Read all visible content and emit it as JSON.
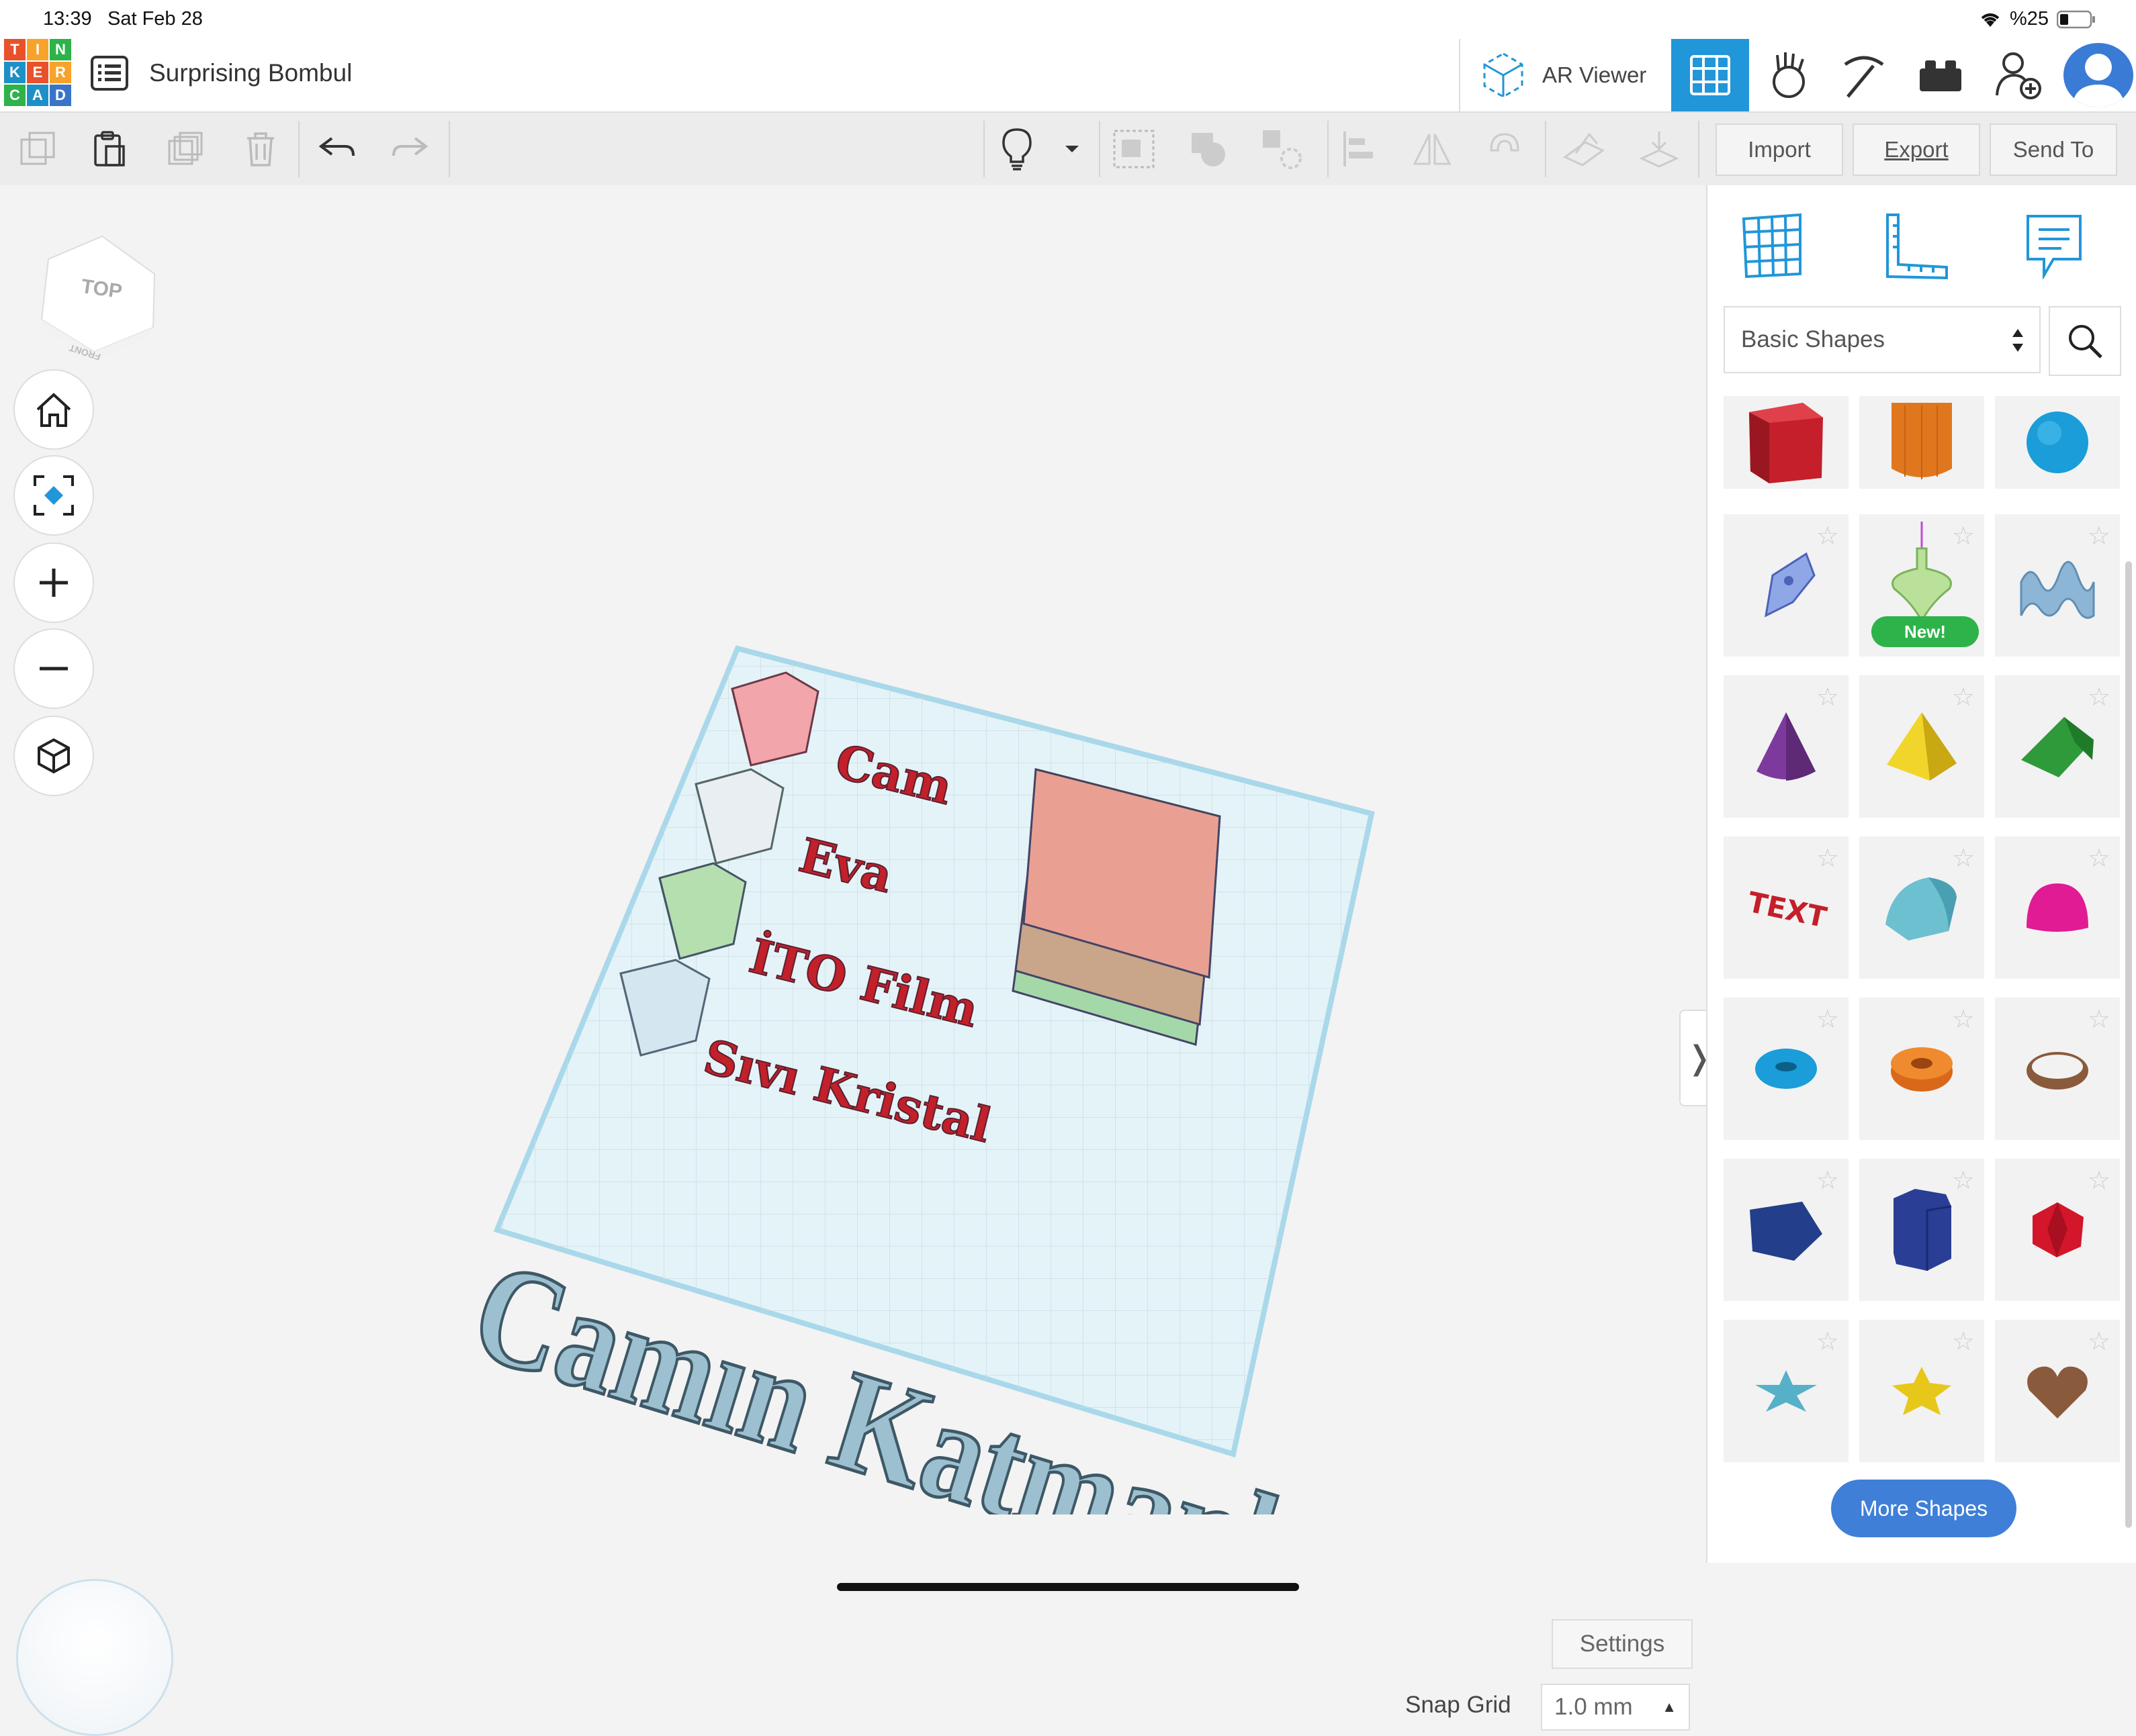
{
  "status_bar": {
    "time": "13:39",
    "date": "Sat Feb 28",
    "battery": "%25"
  },
  "header": {
    "logo_letters": [
      "T",
      "I",
      "N",
      "K",
      "E",
      "R",
      "C",
      "A",
      "D"
    ],
    "design_title": "Surprising Bombul",
    "ar_viewer_label": "AR Viewer"
  },
  "toolbar": {
    "import_label": "Import",
    "export_label": "Export",
    "send_to_label": "Send To"
  },
  "viewcube": {
    "top_label": "TOP",
    "front_label": "FRONT"
  },
  "scene": {
    "labels": [
      "Cam",
      "Eva",
      "İTO Film",
      "Sıvı Kristal"
    ],
    "title_text": "Camın Katmanları"
  },
  "panel": {
    "category": "Basic Shapes",
    "new_badge": "New!",
    "more_shapes_label": "More Shapes"
  },
  "bottom": {
    "settings_label": "Settings",
    "snap_grid_label": "Snap Grid",
    "snap_grid_value": "1.0 mm"
  },
  "colors": {
    "accent": "#2196d9",
    "button_blue": "#3f7fd7",
    "new_green": "#2db34a"
  }
}
